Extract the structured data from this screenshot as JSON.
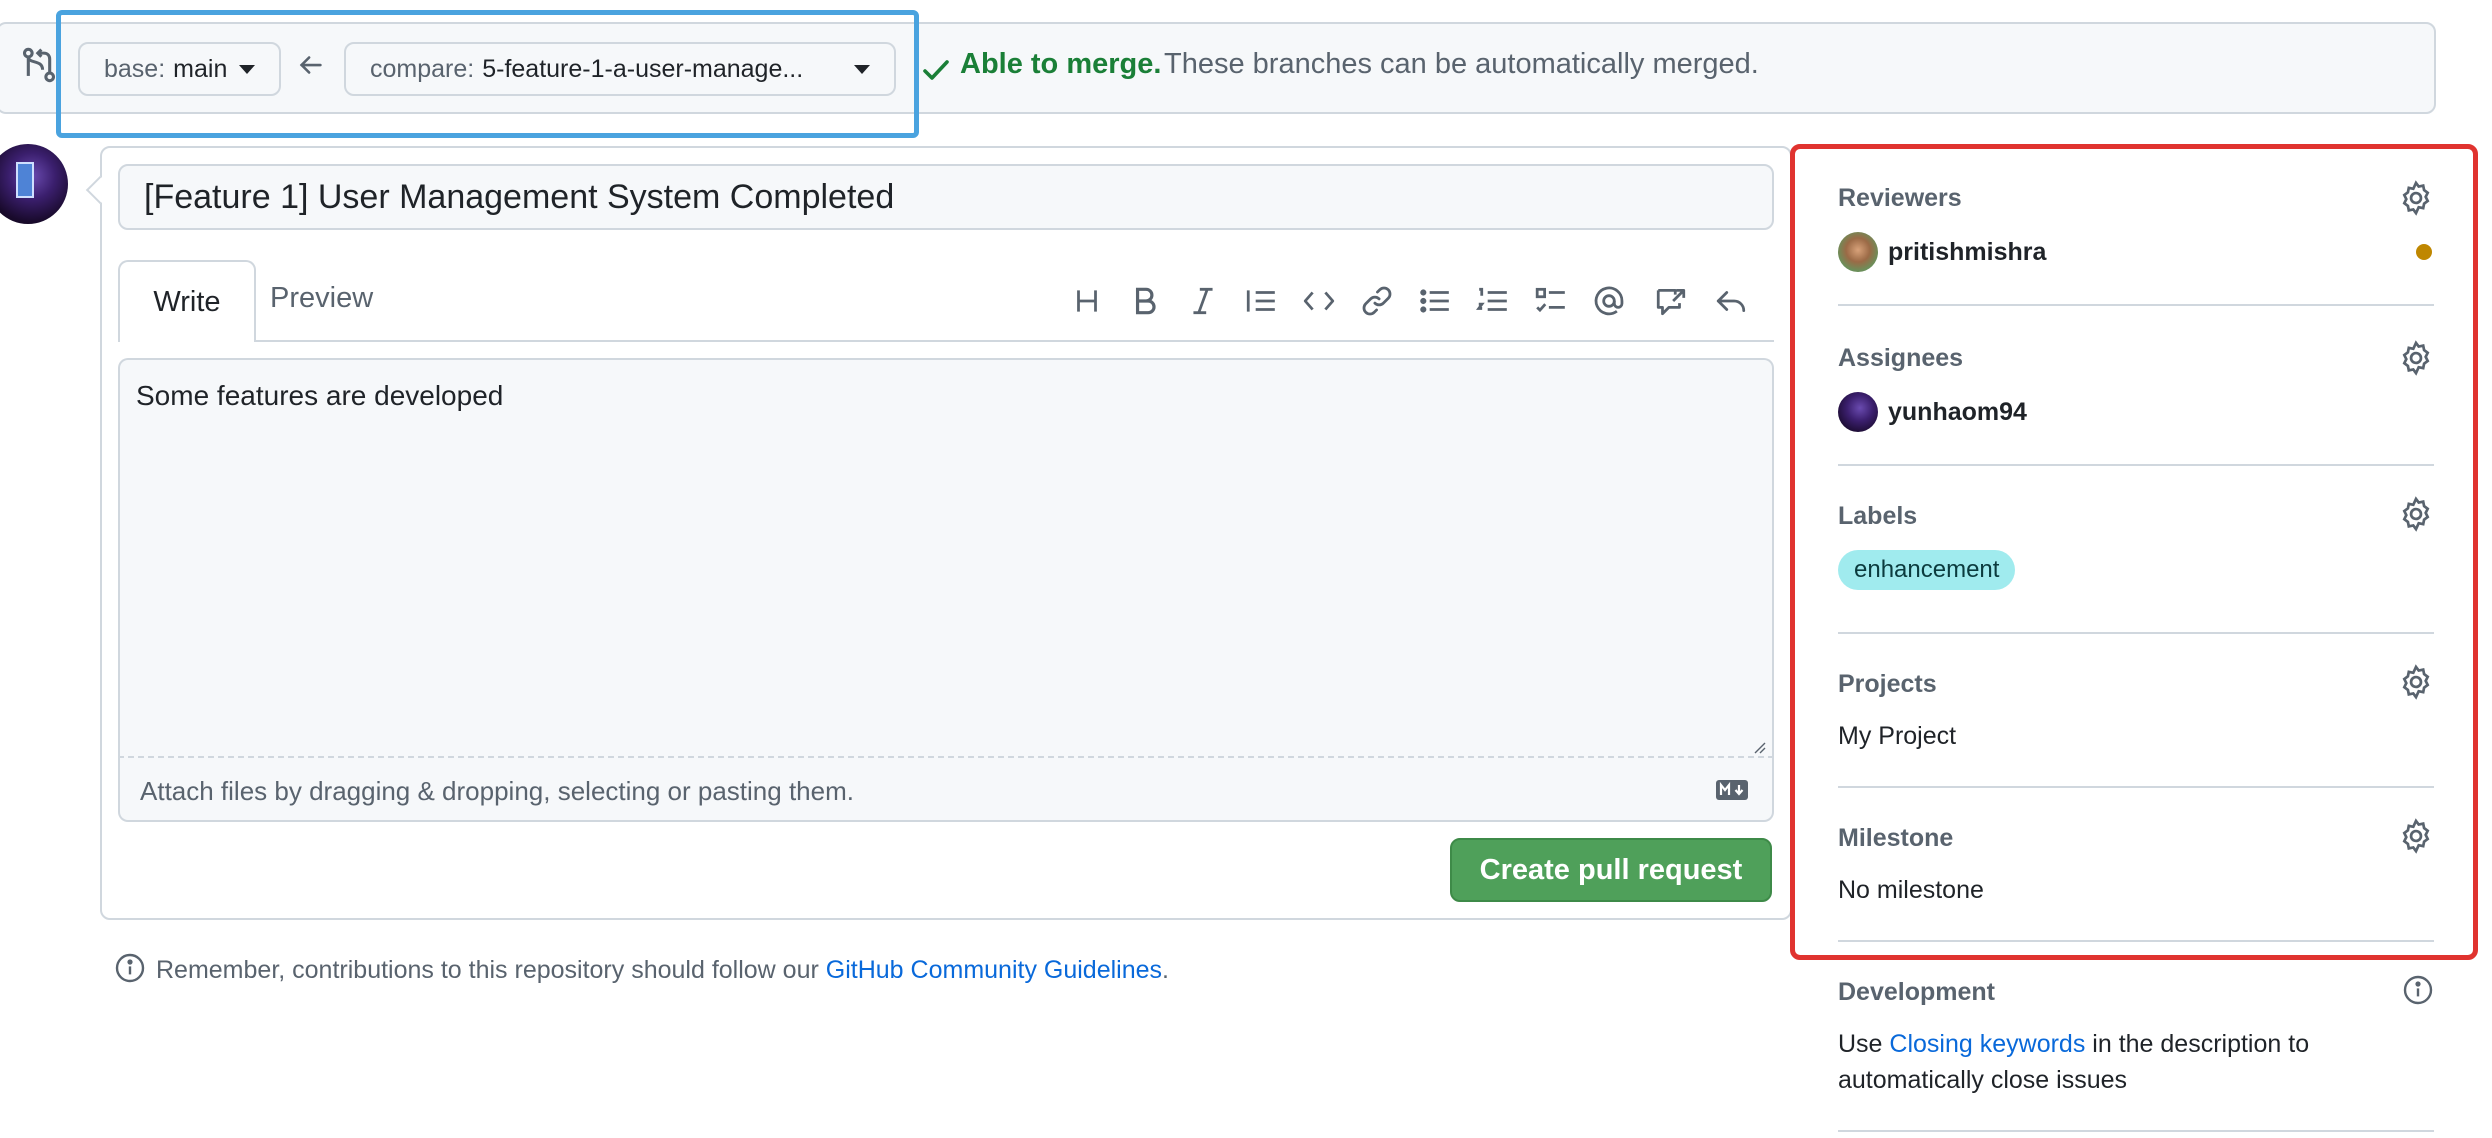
{
  "compare": {
    "base_prefix": "base:",
    "base_value": "main",
    "compare_prefix": "compare:",
    "compare_value": "5-feature-1-a-user-manage...",
    "merge_status": "Able to merge.",
    "merge_description": "These branches can be automatically merged."
  },
  "composer": {
    "title_value": "[Feature 1] User Management System Completed",
    "tab_write": "Write",
    "tab_preview": "Preview",
    "toolbar_icons": [
      "heading-icon",
      "bold-icon",
      "italic-icon",
      "quote-icon",
      "code-icon",
      "link-icon",
      "unordered-list-icon",
      "ordered-list-icon",
      "task-list-icon",
      "mention-icon",
      "cross-reference-icon",
      "saved-replies-icon"
    ],
    "body_value": "Some features are developed",
    "attach_hint": "Attach files by dragging & dropping, selecting or pasting them.",
    "submit_label": "Create pull request"
  },
  "guidelines": {
    "prefix": "Remember, contributions to this repository should follow our",
    "link": "GitHub Community Guidelines",
    "suffix": "."
  },
  "sidebar": {
    "reviewers": {
      "heading": "Reviewers",
      "user": "pritishmishra"
    },
    "assignees": {
      "heading": "Assignees",
      "user": "yunhaom94"
    },
    "labels": {
      "heading": "Labels",
      "label": "enhancement",
      "label_color": "#a0ebee"
    },
    "projects": {
      "heading": "Projects",
      "value": "My Project"
    },
    "milestone": {
      "heading": "Milestone",
      "value": "No milestone"
    },
    "development": {
      "heading": "Development",
      "prefix": "Use",
      "link": "Closing keywords",
      "suffix": "in the description to",
      "line2": "automatically close issues"
    }
  },
  "colors": {
    "success": "#1a7f37",
    "create_button": "#4fa05a",
    "highlight_blue": "#4aa3df",
    "highlight_red": "#e0332f",
    "link": "#0969da"
  }
}
